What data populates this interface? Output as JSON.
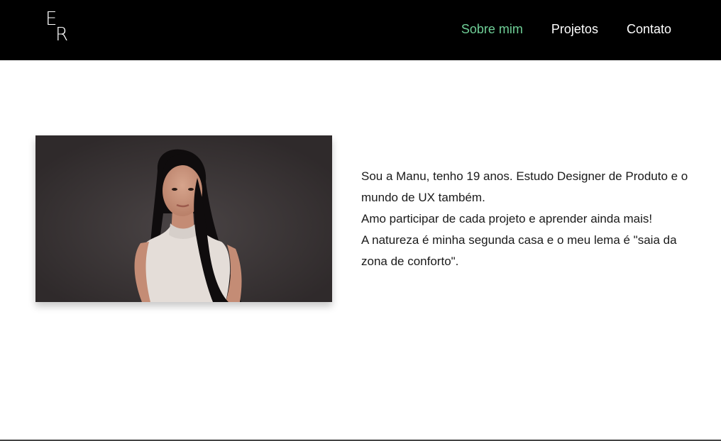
{
  "header": {
    "logo": {
      "letter_top": "E",
      "letter_bottom": "R"
    },
    "nav": [
      {
        "label": "Sobre mim",
        "active": true
      },
      {
        "label": "Projetos",
        "active": false
      },
      {
        "label": "Contato",
        "active": false
      }
    ]
  },
  "about": {
    "photo_icon": "portrait-photo",
    "bio_lines": [
      "Sou a Manu, tenho 19 anos. Estudo Designer de Produto e o mundo de UX também.",
      "Amo participar de cada projeto e aprender ainda mais!",
      "A natureza é minha segunda casa e o meu lema é \"saia da zona de conforto\"."
    ]
  },
  "colors": {
    "header_bg": "#000000",
    "nav_active": "#6fcf97",
    "nav_text": "#ffffff",
    "photo_bg": "#3a3536"
  }
}
